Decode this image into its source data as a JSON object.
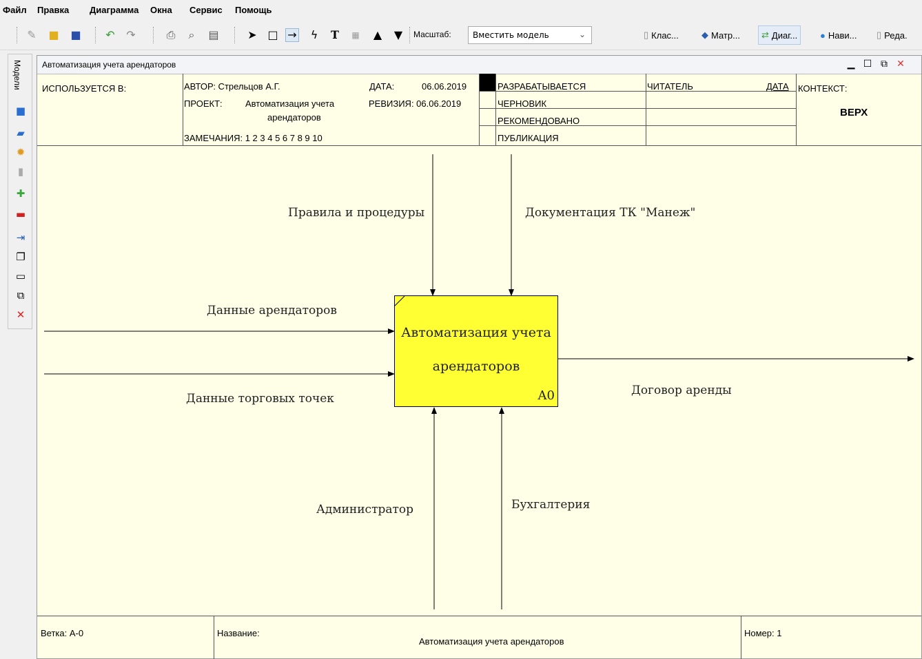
{
  "menu": [
    "Файл",
    "Правка",
    "Диаграмма",
    "Окна",
    "Сервис",
    "Помощь"
  ],
  "toolbar": {
    "scale_label": "Масштаб:",
    "scale_value": "Вместить модель",
    "panels": [
      {
        "label": "Клас...",
        "icon": "class-icon"
      },
      {
        "label": "Матр...",
        "icon": "matrix-icon"
      },
      {
        "label": "Диаг...",
        "icon": "diagram-icon"
      },
      {
        "label": "Нави...",
        "icon": "navigator-icon"
      },
      {
        "label": "Реда.",
        "icon": "editor-icon"
      }
    ]
  },
  "sidebar": {
    "title": "Модели"
  },
  "window": {
    "title": "Автоматизация учета арендаторов"
  },
  "header": {
    "used_in": "ИСПОЛЬЗУЕТСЯ В:",
    "author": "АВТОР: Стрельцов А.Г.",
    "date_label": "ДАТА:",
    "date_value": "06.06.2019",
    "project_label": "ПРОЕКТ:",
    "project_value_line1": "Автоматизация учета",
    "project_value_line2": "арендаторов",
    "revision": "РЕВИЗИЯ: 06.06.2019",
    "notes": "ЗАМЕЧАНИЯ: 1 2 3 4 5 6 7 8 9 10",
    "status": [
      "РАЗРАБАТЫВАЕТСЯ",
      "ЧЕРНОВИК",
      "РЕКОМЕНДОВАНО",
      "ПУБЛИКАЦИЯ"
    ],
    "reader": "ЧИТАТЕЛЬ",
    "reader_date": "ДАТА",
    "context": "КОНТЕКСТ:",
    "context_value": "ВЕРХ"
  },
  "diagram": {
    "controls": [
      "Правила и процедуры",
      "Документация ТК \"Манеж\""
    ],
    "inputs": [
      "Данные арендаторов",
      "Данные торговых точек"
    ],
    "output": "Договор аренды",
    "mechanisms": [
      "Администратор",
      "Бухгалтерия"
    ],
    "box_line1": "Автоматизация учета",
    "box_line2": "арендаторов",
    "box_number": "A0",
    "box_color": "#ffff33"
  },
  "footer": {
    "node": "Ветка: A-0",
    "name_label": "Название:",
    "name_value": "Автоматизация учета арендаторов",
    "number": "Номер: 1"
  }
}
